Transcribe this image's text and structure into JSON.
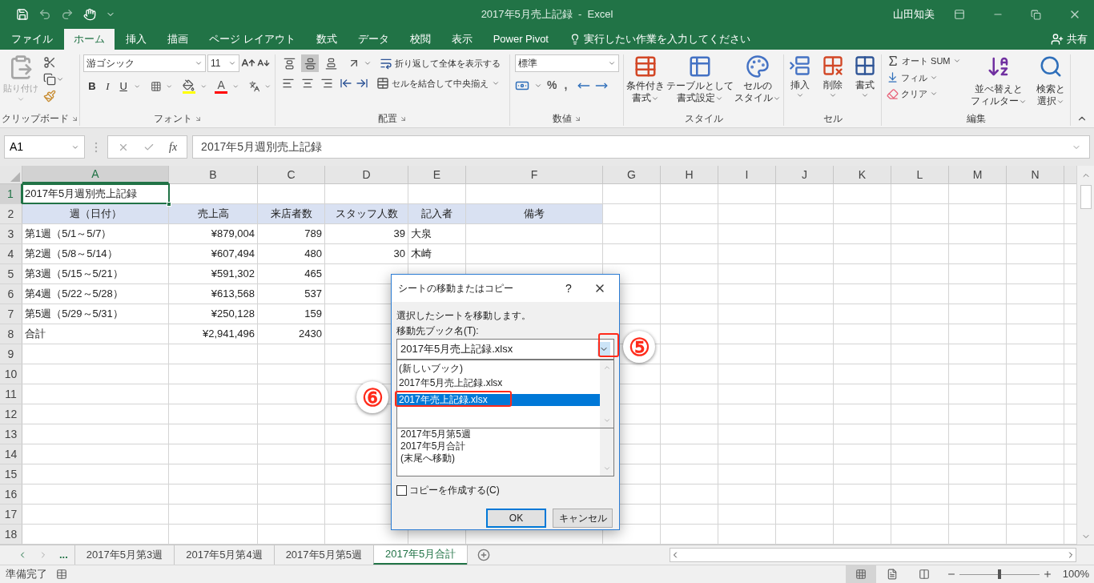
{
  "title_bar": {
    "title": "2017年5月売上記録  -  Excel",
    "user": "山田知美"
  },
  "menu_tabs": [
    {
      "label": "ファイル",
      "selected": false
    },
    {
      "label": "ホーム",
      "selected": true
    },
    {
      "label": "挿入",
      "selected": false
    },
    {
      "label": "描画",
      "selected": false
    },
    {
      "label": "ページ レイアウト",
      "selected": false
    },
    {
      "label": "数式",
      "selected": false
    },
    {
      "label": "データ",
      "selected": false
    },
    {
      "label": "校閲",
      "selected": false
    },
    {
      "label": "表示",
      "selected": false
    },
    {
      "label": "Power Pivot",
      "selected": false
    }
  ],
  "tell_me": "実行したい作業を入力してください",
  "share": "共有",
  "ribbon": {
    "clipboard": {
      "paste": "貼り付け",
      "paste_disabled": true,
      "label": "クリップボード"
    },
    "font": {
      "name": "游ゴシック",
      "size": "11",
      "bold": "B",
      "italic": "I",
      "underline": "U",
      "font_color": "A",
      "label": "フォント"
    },
    "alignment": {
      "vertical": [
        {
          "kind": "top",
          "selected": false
        },
        {
          "kind": "middle",
          "selected": true
        },
        {
          "kind": "bottom",
          "selected": false
        }
      ],
      "wrap": "折り返して全体を表示する",
      "merge": "セルを結合して中央揃え",
      "label": "配置"
    },
    "number": {
      "format": "標準",
      "percent": "%",
      "comma": ",",
      "label": "数値"
    },
    "styles": {
      "buttons": [
        {
          "kind": "conditional",
          "lines": [
            "条件付き",
            "書式"
          ]
        },
        {
          "kind": "table",
          "lines": [
            "テーブルとして",
            "書式設定"
          ]
        },
        {
          "kind": "cellstyle",
          "lines": [
            "セルの",
            "スタイル"
          ]
        }
      ],
      "label": "スタイル"
    },
    "cells": {
      "buttons": [
        {
          "kind": "insert",
          "label": "挿入"
        },
        {
          "kind": "delete",
          "label": "削除"
        },
        {
          "kind": "format",
          "label": "書式"
        }
      ],
      "label": "セル"
    },
    "editing": {
      "autosum": "オート SUM",
      "fill": "フィル",
      "clear": "クリア",
      "buttons": [
        {
          "kind": "sort",
          "lines": [
            "並べ替えと",
            "フィルター"
          ]
        },
        {
          "kind": "find",
          "lines": [
            "検索と",
            "選択"
          ]
        }
      ],
      "label": "編集"
    }
  },
  "formula_bar": {
    "name_box": "A1",
    "fx": "fx",
    "content": "2017年5月週別売上記録"
  },
  "sheet": {
    "columns": [
      {
        "label": "A",
        "selected": true
      },
      {
        "label": "B",
        "selected": false
      },
      {
        "label": "C",
        "selected": false
      },
      {
        "label": "D",
        "selected": false
      },
      {
        "label": "E",
        "selected": false
      },
      {
        "label": "F",
        "selected": false
      },
      {
        "label": "G",
        "selected": false
      },
      {
        "label": "H",
        "selected": false
      },
      {
        "label": "I",
        "selected": false
      },
      {
        "label": "J",
        "selected": false
      },
      {
        "label": "K",
        "selected": false
      },
      {
        "label": "L",
        "selected": false
      },
      {
        "label": "M",
        "selected": false
      },
      {
        "label": "N",
        "selected": false
      }
    ],
    "rows": [
      {
        "number": "1",
        "selected": true,
        "header": false,
        "cells": [
          "2017年5月週別売上記録"
        ]
      },
      {
        "number": "2",
        "selected": false,
        "header": true,
        "cells": [
          "週（日付）",
          "売上高",
          "来店者数",
          "スタッフ人数",
          "記入者",
          "備考"
        ]
      },
      {
        "number": "3",
        "selected": false,
        "header": false,
        "cells": [
          "第1週（5/1～5/7）",
          "¥879,004",
          "789",
          "39",
          "大泉"
        ]
      },
      {
        "number": "4",
        "selected": false,
        "header": false,
        "cells": [
          "第2週（5/8～5/14）",
          "¥607,494",
          "480",
          "30",
          "木崎"
        ]
      },
      {
        "number": "5",
        "selected": false,
        "header": false,
        "cells": [
          "第3週（5/15～5/21）",
          "¥591,302",
          "465"
        ]
      },
      {
        "number": "6",
        "selected": false,
        "header": false,
        "cells": [
          "第4週（5/22～5/28）",
          "¥613,568",
          "537"
        ]
      },
      {
        "number": "7",
        "selected": false,
        "header": false,
        "cells": [
          "第5週（5/29～5/31）",
          "¥250,128",
          "159"
        ]
      },
      {
        "number": "8",
        "selected": false,
        "header": false,
        "cells": [
          "合計",
          "¥2,941,496",
          "2430"
        ]
      },
      {
        "number": "9",
        "selected": false,
        "header": false,
        "cells": []
      },
      {
        "number": "10",
        "selected": false,
        "header": false,
        "cells": []
      },
      {
        "number": "11",
        "selected": false,
        "header": false,
        "cells": []
      },
      {
        "number": "12",
        "selected": false,
        "header": false,
        "cells": []
      },
      {
        "number": "13",
        "selected": false,
        "header": false,
        "cells": []
      },
      {
        "number": "14",
        "selected": false,
        "header": false,
        "cells": []
      },
      {
        "number": "15",
        "selected": false,
        "header": false,
        "cells": []
      },
      {
        "number": "16",
        "selected": false,
        "header": false,
        "cells": []
      },
      {
        "number": "17",
        "selected": false,
        "header": false,
        "cells": []
      },
      {
        "number": "18",
        "selected": false,
        "header": false,
        "cells": []
      }
    ]
  },
  "sheet_tabs": {
    "more": "...",
    "tabs": [
      {
        "label": "2017年5月第3週",
        "selected": false
      },
      {
        "label": "2017年5月第4週",
        "selected": false
      },
      {
        "label": "2017年5月第5週",
        "selected": false
      },
      {
        "label": "2017年5月合計",
        "selected": true
      }
    ]
  },
  "status_bar": {
    "status": "準備完了",
    "zoom": "100%",
    "zoom_slider": {
      "level": 0.5
    }
  },
  "dialog": {
    "title": "シートの移動またはコピー",
    "help": "?",
    "message": "選択したシートを移動します。",
    "book_label": "移動先ブック名(T):",
    "book_value": "2017年5月売上記録.xlsx",
    "dropdown_items": [
      {
        "label": "(新しいブック)",
        "selected": false
      },
      {
        "label": "2017年5月売上記録.xlsx",
        "selected": false
      },
      {
        "label": "2017年売上記録.xlsx",
        "selected": true
      }
    ],
    "sheet_list": [
      "2017年5月第5週",
      "2017年5月合計",
      "(末尾へ移動)"
    ],
    "copy_checkbox": {
      "label": "コピーを作成する(C)",
      "checked": false
    },
    "buttons": [
      {
        "label": "OK",
        "default": true
      },
      {
        "label": "キャンセル",
        "default": false
      }
    ]
  },
  "annotations": [
    {
      "label": "⑤"
    },
    {
      "label": "⑥"
    }
  ]
}
